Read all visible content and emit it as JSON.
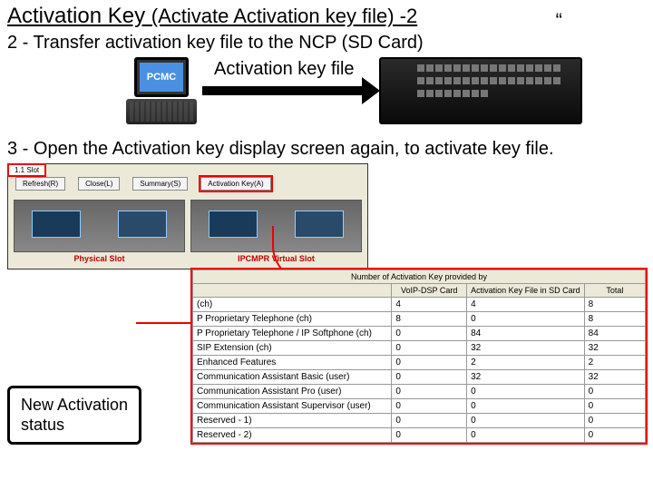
{
  "title_main": "Activation Key",
  "title_sub": "(Activate Activation key file) -2",
  "quote": "“",
  "step2": "2 - Transfer activation key file to the NCP (SD Card)",
  "laptop_label": "PCMC",
  "arrow_label": "Activation key file",
  "step3": "3 - Open the Activation key display screen again, to activate key file.",
  "shot1": {
    "tab": "1.1 Slot",
    "buttons": {
      "refresh": "Refresh(R)",
      "close": "Close(L)",
      "summary": "Summary(S)",
      "actkey": "Activation Key(A)"
    },
    "phys_label": "Physical Slot",
    "virt_label": "IPCMPR Virtual Slot"
  },
  "table": {
    "superhead": "Number of Activation Key provided by",
    "headers": {
      "feature": "",
      "dsp": "VoIP-DSP Card",
      "file": "Activation Key File in SD Card",
      "total": "Total"
    },
    "rows": [
      {
        "feature": "(ch)",
        "dsp": "4",
        "file": "4",
        "total": "8"
      },
      {
        "feature": "P Proprietary Telephone (ch)",
        "dsp": "8",
        "file": "0",
        "total": "8"
      },
      {
        "feature": "P Proprietary Telephone / IP Softphone (ch)",
        "dsp": "0",
        "file": "84",
        "total": "84"
      },
      {
        "feature": "SIP Extension (ch)",
        "dsp": "0",
        "file": "32",
        "total": "32"
      },
      {
        "feature": "Enhanced Features",
        "dsp": "0",
        "file": "2",
        "total": "2"
      },
      {
        "feature": "Communication Assistant Basic (user)",
        "dsp": "0",
        "file": "32",
        "total": "32"
      },
      {
        "feature": "Communication Assistant Pro (user)",
        "dsp": "0",
        "file": "0",
        "total": "0"
      },
      {
        "feature": "Communication Assistant Supervisor (user)",
        "dsp": "0",
        "file": "0",
        "total": "0"
      },
      {
        "feature": "Reserved - 1)",
        "dsp": "0",
        "file": "0",
        "total": "0"
      },
      {
        "feature": "Reserved - 2)",
        "dsp": "0",
        "file": "0",
        "total": "0"
      }
    ]
  },
  "callout": "New Activation\nstatus"
}
